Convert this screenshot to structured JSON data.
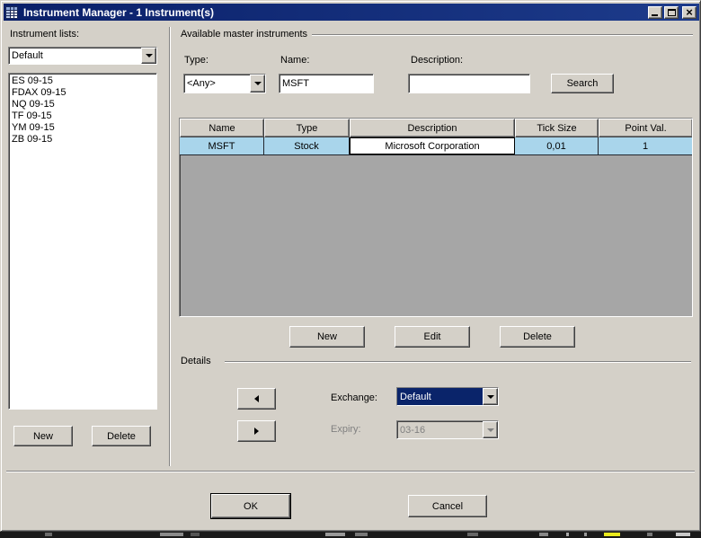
{
  "window": {
    "title": "Instrument Manager - 1 Instrument(s)"
  },
  "left_panel": {
    "label": "Instrument lists:",
    "list_dropdown_value": "Default",
    "items": [
      "ES 09-15",
      "FDAX 09-15",
      "NQ 09-15",
      "TF 09-15",
      "YM 09-15",
      "ZB 09-15"
    ],
    "new_button": "New",
    "delete_button": "Delete"
  },
  "master_instruments": {
    "section_label": "Available master instruments",
    "type_label": "Type:",
    "type_value": "<Any>",
    "name_label": "Name:",
    "name_value": "MSFT",
    "description_label": "Description:",
    "description_value": "",
    "search_button": "Search",
    "table": {
      "columns": [
        "Name",
        "Type",
        "Description",
        "Tick Size",
        "Point Val."
      ],
      "rows": [
        [
          "MSFT",
          "Stock",
          "Microsoft Corporation",
          "0,01",
          "1"
        ]
      ]
    },
    "new_button": "New",
    "edit_button": "Edit",
    "delete_button": "Delete"
  },
  "details": {
    "section_label": "Details",
    "exchange_label": "Exchange:",
    "exchange_value": "Default",
    "expiry_label": "Expiry:",
    "expiry_value": "03-16"
  },
  "footer": {
    "ok_button": "OK",
    "cancel_button": "Cancel"
  },
  "colors": {
    "title_bar": "#0a2069",
    "dialog_bg": "#d4d0c8",
    "selected_row": "#a9d5eb",
    "table_bg": "#a6a6a6",
    "selection": "#0a246a"
  }
}
